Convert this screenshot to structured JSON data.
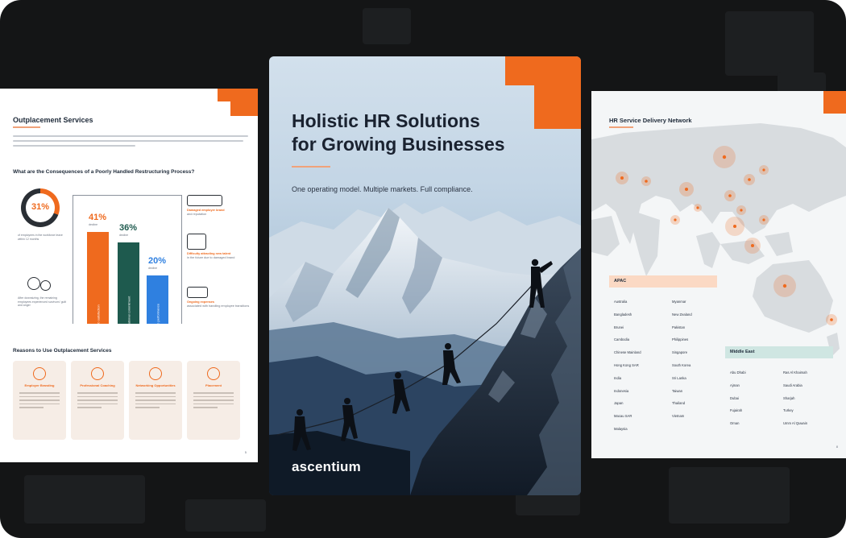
{
  "left_page": {
    "title": "Outplacement Services",
    "question": "What are the Consequences of a Poorly Handled Restructuring Process?",
    "donut_value": "31%",
    "stat_note_1": "of employees in the workforce leave within 12 months",
    "stat_note_2": "After downsizing, the remaining employees experienced survivors' guilt and anger",
    "bars": [
      {
        "pct": "41%",
        "caption": "decline",
        "label": "job satisfaction",
        "color": "#ef6a1e"
      },
      {
        "pct": "36%",
        "caption": "decline",
        "label": "organizational commitment",
        "color": "#1e5a4e"
      },
      {
        "pct": "20%",
        "caption": "decline",
        "label": "job performance",
        "color": "#2f80e0"
      }
    ],
    "side_items": [
      {
        "label": "Damaged employer brand",
        "sub": "and reputation"
      },
      {
        "label": "Difficulty attracting new talent",
        "sub": "in the future due to damaged brand"
      },
      {
        "label": "Ongoing expenses",
        "sub": "associated with handling employee transitions"
      }
    ],
    "reasons_title": "Reasons to Use Outplacement Services",
    "reasons": [
      {
        "title": "Employer Branding"
      },
      {
        "title": "Professional Coaching"
      },
      {
        "title": "Networking Opportunities"
      },
      {
        "title": "Placement"
      }
    ],
    "page_number": "5"
  },
  "cover": {
    "title_line1": "Holistic HR Solutions",
    "title_line2": "for Growing Businesses",
    "subtitle": "One operating model. Multiple markets. Full compliance.",
    "brand": "ascentium"
  },
  "right_page": {
    "title": "HR Service Delivery Network",
    "apac_label": "APAC",
    "apac_col1": [
      "Australia",
      "Bangladesh",
      "Brunei",
      "Cambodia",
      "Chinese Mainland",
      "Hong Kong SAR",
      "India",
      "Indonesia",
      "Japan",
      "Macau SAR",
      "Malaysia"
    ],
    "apac_col2": [
      "Myanmar",
      "New Zealand",
      "Pakistan",
      "Philippines",
      "Singapore",
      "South Korea",
      "Sri Lanka",
      "Taiwan",
      "Thailand",
      "Vietnam"
    ],
    "me_label": "Middle East",
    "me_col1": [
      "Abu Dhabi",
      "Ajman",
      "Dubai",
      "Fujairah",
      "Oman"
    ],
    "me_col2": [
      "Ras Al Khaimah",
      "Saudi Arabia",
      "Sharjah",
      "Turkey",
      "Umm Al Quwain"
    ],
    "page_number": "8"
  },
  "colors": {
    "accent": "#ef6a1e",
    "frame": "#141516",
    "apac_head": "#fbd9c4",
    "me_head": "#cfe6e2"
  }
}
